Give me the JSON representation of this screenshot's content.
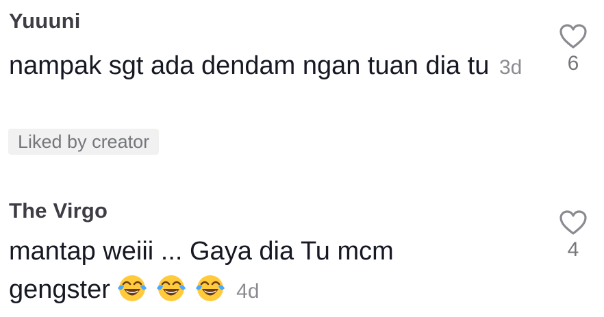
{
  "comments": [
    {
      "username": "Yuuuni",
      "text": "nampak sgt ada dendam ngan tuan dia tu",
      "time": "3d",
      "badge": "Liked by creator",
      "likes": "6"
    },
    {
      "username": "The Virgo",
      "text": "mantap weiii ... Gaya dia Tu mcm gengster",
      "emojis": [
        "😂",
        "😂",
        "😂"
      ],
      "time": "4d",
      "likes": "4"
    }
  ],
  "icons": {
    "like": "heart-outline-icon",
    "emoji": "face-with-tears-of-joy-icon"
  },
  "colors": {
    "text": "#161823",
    "username": "#3d3d45",
    "muted": "#8a8b91",
    "badge_bg": "#f1f1f2"
  }
}
